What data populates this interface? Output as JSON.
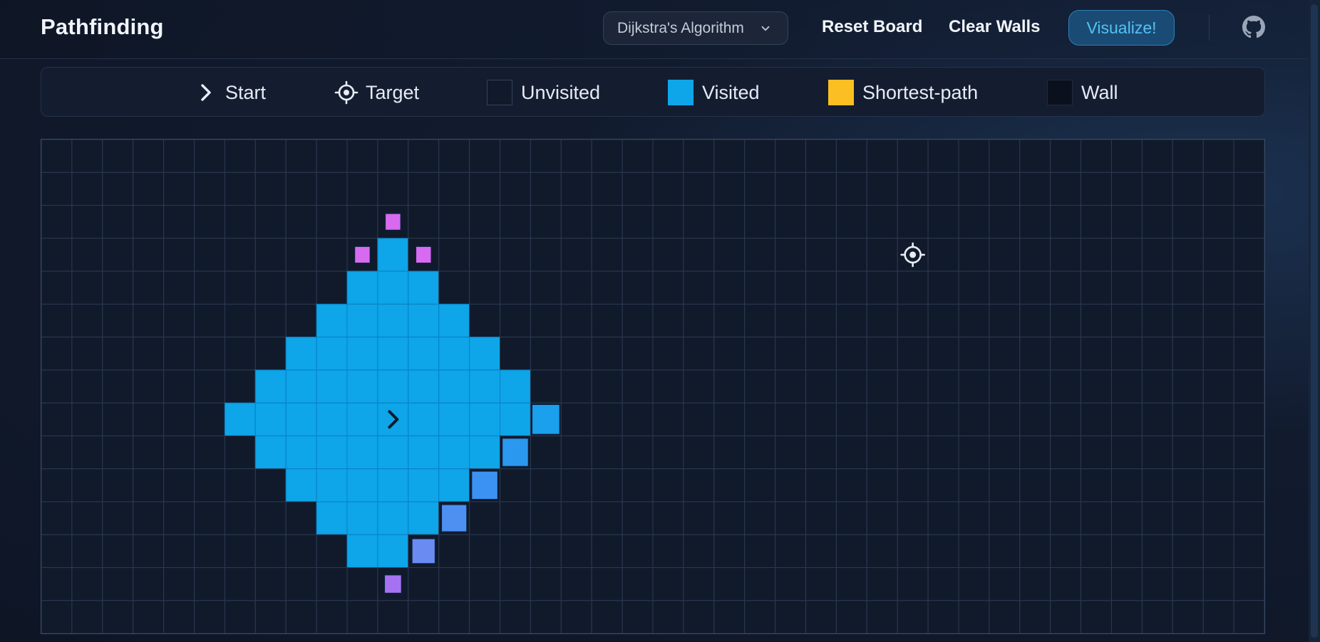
{
  "header": {
    "brand": "Pathfinding",
    "algorithm_select": {
      "value": "Dijkstra's Algorithm",
      "icon": "chevron-down-icon"
    },
    "reset_label": "Reset Board",
    "clear_walls_label": "Clear Walls",
    "visualize_label": "Visualize!",
    "github_icon": "github-icon"
  },
  "legend": [
    {
      "key": "start",
      "label": "Start",
      "icon": "chevron-right-icon"
    },
    {
      "key": "target",
      "label": "Target",
      "icon": "crosshair-icon"
    },
    {
      "key": "unvisited",
      "label": "Unvisited",
      "color": "#111a2b"
    },
    {
      "key": "visited",
      "label": "Visited",
      "color": "#0ea5e9"
    },
    {
      "key": "shortest",
      "label": "Shortest-path",
      "color": "#fbbf24"
    },
    {
      "key": "wall",
      "label": "Wall",
      "color": "#0a101c"
    }
  ],
  "board": {
    "cols": 40,
    "rows": 15,
    "start": {
      "row": 8,
      "col": 11
    },
    "target": {
      "row": 3,
      "col": 28
    },
    "visited_rows": [
      {
        "row": 3,
        "from": 11,
        "to": 11
      },
      {
        "row": 4,
        "from": 10,
        "to": 12
      },
      {
        "row": 5,
        "from": 9,
        "to": 13
      },
      {
        "row": 6,
        "from": 8,
        "to": 14
      },
      {
        "row": 7,
        "from": 7,
        "to": 15
      },
      {
        "row": 8,
        "from": 6,
        "to": 15
      },
      {
        "row": 9,
        "from": 7,
        "to": 14
      },
      {
        "row": 10,
        "from": 8,
        "to": 13
      },
      {
        "row": 11,
        "from": 9,
        "to": 12
      },
      {
        "row": 12,
        "from": 10,
        "to": 11
      }
    ],
    "frontier": [
      {
        "row": 8,
        "col": 16,
        "color": "#1ba0ee",
        "scale": 0.9
      },
      {
        "row": 9,
        "col": 15,
        "color": "#2b98f0",
        "scale": 0.85
      },
      {
        "row": 10,
        "col": 14,
        "color": "#3b92f2",
        "scale": 0.85
      },
      {
        "row": 11,
        "col": 13,
        "color": "#4d90f2",
        "scale": 0.82
      },
      {
        "row": 12,
        "col": 12,
        "color": "#6a8cf2",
        "scale": 0.75
      },
      {
        "row": 13,
        "col": 11,
        "color": "#a672f2",
        "scale": 0.55
      },
      {
        "row": 2,
        "col": 11,
        "color": "#d86af0",
        "scale": 0.5
      },
      {
        "row": 3,
        "col": 10,
        "color": "#d86af0",
        "scale": 0.5
      },
      {
        "row": 3,
        "col": 12,
        "color": "#d86af0",
        "scale": 0.5
      }
    ],
    "colors": {
      "unvisited": "#111a2b",
      "grid_line": "#2b3a52",
      "visited": "#0ea5e9",
      "visited_border": "#0b7fbf",
      "start_icon": "#0f1a2a",
      "target_icon": "#e8edf6"
    }
  }
}
